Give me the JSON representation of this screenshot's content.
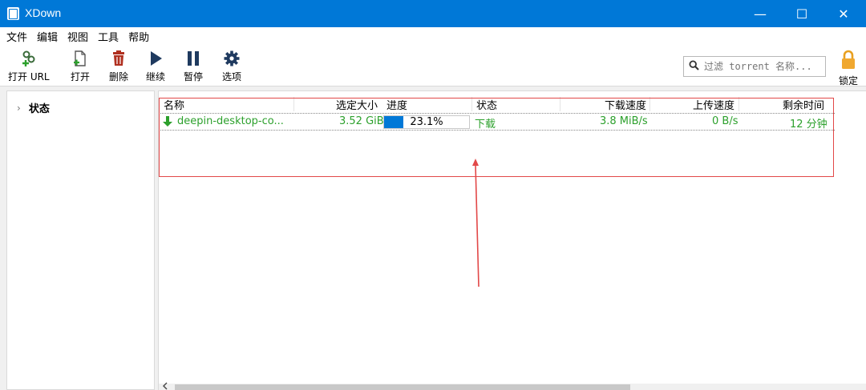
{
  "window": {
    "title": "XDown",
    "minimize_glyph": "—",
    "maximize_glyph": "☐",
    "close_glyph": "✕"
  },
  "menu": [
    "文件",
    "编辑",
    "视图",
    "工具",
    "帮助"
  ],
  "toolbar": {
    "open_url": "打开 URL",
    "open": "打开",
    "delete": "删除",
    "resume": "继续",
    "pause": "暂停",
    "options": "选项",
    "filter_placeholder": "过滤 torrent 名称...",
    "lock": "锁定"
  },
  "sidebar": {
    "items": [
      {
        "label": "状态",
        "chevron": "›"
      }
    ]
  },
  "table": {
    "columns": [
      "名称",
      "选定大小",
      "进度",
      "状态",
      "下载速度",
      "上传速度",
      "剩余时间"
    ],
    "rows": [
      {
        "name": "deepin-desktop-co...",
        "size": "3.52 GiB",
        "progress": "23.1%",
        "progress_fraction": 0.231,
        "status": "下载",
        "down_speed": "3.8 MiB/s",
        "up_speed": "0 B/s",
        "remaining": "12 分钟"
      }
    ]
  },
  "colors": {
    "titlebar": "#0078d7",
    "accent_green": "#2ca02c",
    "annotation_red": "#e24848"
  }
}
